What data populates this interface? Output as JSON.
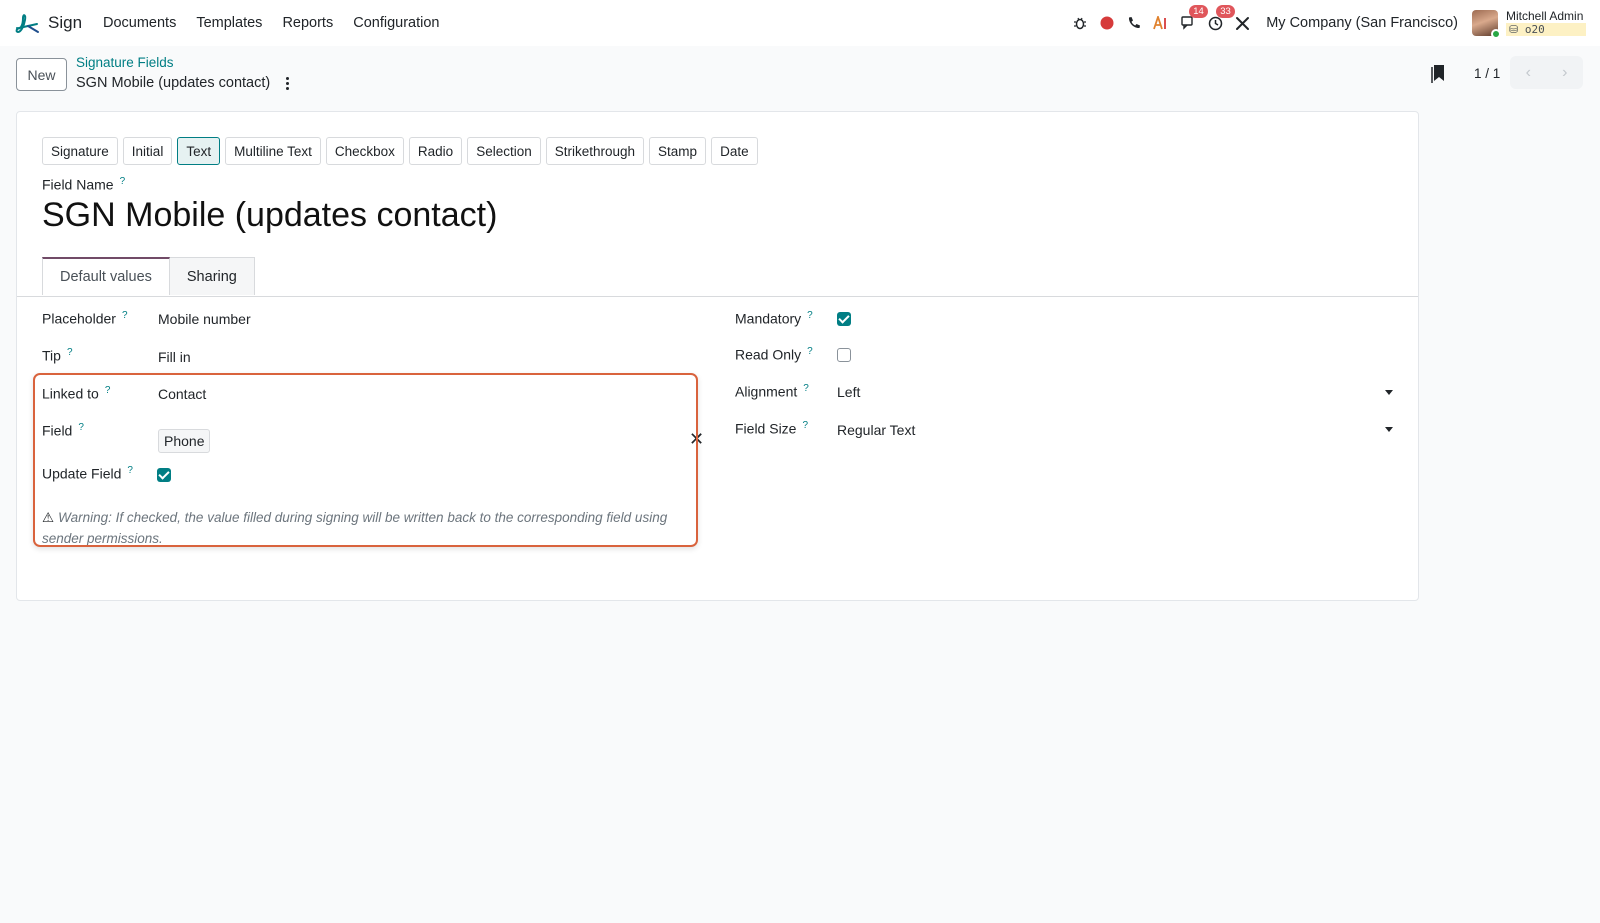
{
  "navbar": {
    "app_name": "Sign",
    "menu": [
      "Documents",
      "Templates",
      "Reports",
      "Configuration"
    ],
    "badges": {
      "messages": "14",
      "activities": "33"
    },
    "company": "My Company (San Francisco)",
    "user_name": "Mitchell Admin",
    "user_db": "o20",
    "icons": [
      "bug-icon",
      "record-icon",
      "phone-icon",
      "ai-icon",
      "chat-icon",
      "clock-icon",
      "tools-icon"
    ]
  },
  "control": {
    "new_label": "New",
    "breadcrumb": "Signature Fields",
    "title": "SGN Mobile (updates contact)",
    "pager": "1 / 1"
  },
  "form": {
    "types": [
      "Signature",
      "Initial",
      "Text",
      "Multiline Text",
      "Checkbox",
      "Radio",
      "Selection",
      "Strikethrough",
      "Stamp",
      "Date"
    ],
    "active_type": "Text",
    "field_name_label": "Field Name",
    "field_name_value": "SGN Mobile (updates contact)",
    "tabs": [
      "Default values",
      "Sharing"
    ],
    "help_mark": "?",
    "left": {
      "placeholder_label": "Placeholder",
      "placeholder_value": "Mobile number",
      "tip_label": "Tip",
      "tip_value": "Fill in",
      "linked_label": "Linked to",
      "linked_value": "Contact",
      "field_label": "Field",
      "field_value": "Phone",
      "update_label": "Update Field",
      "warning": "Warning: If checked, the value filled during signing will be written back to the corresponding field using sender permissions."
    },
    "right": {
      "mandatory_label": "Mandatory",
      "readonly_label": "Read Only",
      "alignment_label": "Alignment",
      "alignment_value": "Left",
      "size_label": "Field Size",
      "size_value": "Regular Text"
    }
  },
  "colors": {
    "accent": "#017e84",
    "highlight": "#d9633d",
    "tab_active": "#714b67"
  }
}
